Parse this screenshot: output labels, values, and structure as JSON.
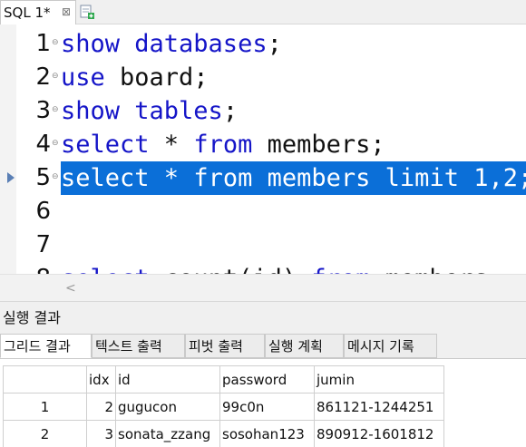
{
  "tabs": [
    {
      "label": "SQL 1*",
      "close": "⊠"
    }
  ],
  "editor": {
    "lines": [
      {
        "no": "1",
        "tokens": [
          {
            "t": "show databases",
            "kw": true
          },
          {
            "t": ";",
            "kw": false
          }
        ]
      },
      {
        "no": "2",
        "tokens": [
          {
            "t": "use",
            "kw": true
          },
          {
            "t": " board;",
            "kw": false
          }
        ]
      },
      {
        "no": "3",
        "tokens": [
          {
            "t": "show tables",
            "kw": true
          },
          {
            "t": ";",
            "kw": false
          }
        ]
      },
      {
        "no": "4",
        "tokens": [
          {
            "t": "select",
            "kw": true
          },
          {
            "t": " * ",
            "kw": false
          },
          {
            "t": "from",
            "kw": true
          },
          {
            "t": " members;",
            "kw": false
          }
        ]
      },
      {
        "no": "5",
        "tokens": [
          {
            "t": "select",
            "kw": true
          },
          {
            "t": " * ",
            "kw": false
          },
          {
            "t": "from",
            "kw": true
          },
          {
            "t": " members ",
            "kw": false
          },
          {
            "t": "limit",
            "kw": true
          },
          {
            "t": " 1,2;",
            "kw": false
          }
        ]
      },
      {
        "no": "6",
        "tokens": []
      },
      {
        "no": "7",
        "tokens": []
      },
      {
        "no": "8",
        "tokens": [
          {
            "t": "select",
            "kw": true
          },
          {
            "t": " count(id) ",
            "kw": false
          },
          {
            "t": "from",
            "kw": true
          },
          {
            "t": " members;",
            "kw": false
          }
        ]
      }
    ],
    "selected_line": 4
  },
  "result": {
    "title": "실행 결과",
    "tabs": [
      "그리드 결과",
      "텍스트 출력",
      "피벗 출력",
      "실행 계획",
      "메시지 기록"
    ],
    "active_tab": 0,
    "columns": [
      "idx",
      "id",
      "password",
      "jumin"
    ],
    "rows": [
      {
        "rownum": "1",
        "cells": [
          "2",
          "gugucon",
          "99c0n",
          "861121-1244251"
        ]
      },
      {
        "rownum": "2",
        "cells": [
          "3",
          "sonata_zzang",
          "sosohan123",
          "890912-1601812"
        ]
      }
    ]
  },
  "colors": {
    "keyword": "#1515c8",
    "selection": "#0b6fd8"
  }
}
